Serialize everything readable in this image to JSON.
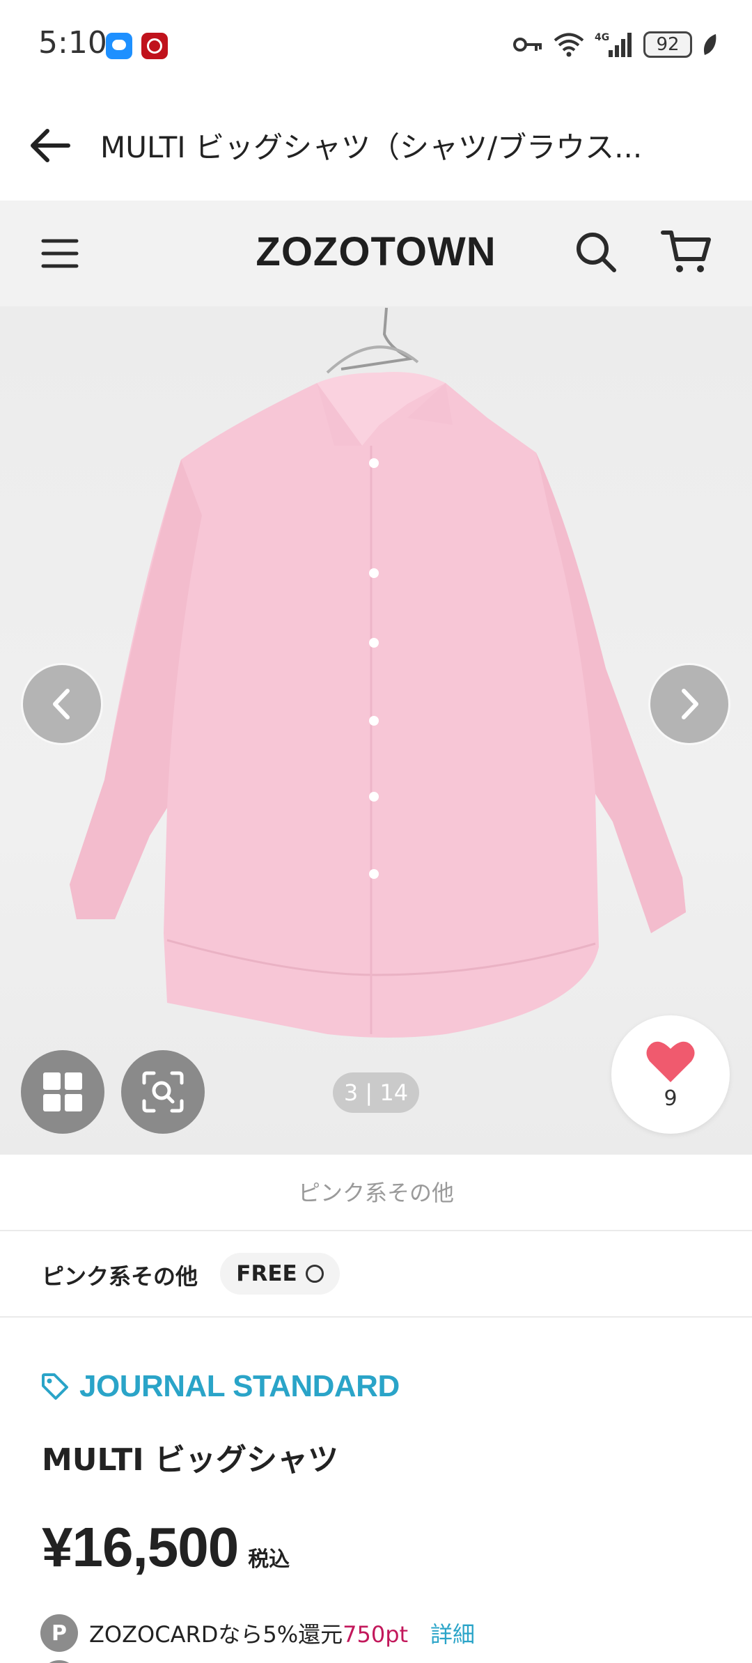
{
  "status_bar": {
    "time": "5:10",
    "battery": "92",
    "icons": [
      "chat-app-icon",
      "bank-app-icon",
      "vpn-key-icon",
      "wifi-icon",
      "signal-4g-icon",
      "battery-icon",
      "leaf-icon"
    ]
  },
  "title_bar": {
    "title": "MULTI ビッグシャツ（シャツ/ブラウス..."
  },
  "site_header": {
    "logo": "ZOZOTOWN"
  },
  "gallery": {
    "pager": "3 | 14",
    "favorite_count": "9",
    "colors": {
      "shirt": "#f7c6d6",
      "heart": "#f05a6e"
    }
  },
  "color_caption": "ピンク系その他",
  "size_row": {
    "color_label": "ピンク系その他",
    "size_label": "FREE"
  },
  "product": {
    "brand": "JOURNAL STANDARD",
    "name": "MULTI ビッグシャツ",
    "price": "¥16,500",
    "tax_label": "税込",
    "points": {
      "badge": "P",
      "text": "ZOZOCARDなら5%還元",
      "value": "750pt",
      "link": "詳細"
    }
  },
  "colors": {
    "brand_accent": "#2aa4c8",
    "points_accent": "#c2185b"
  }
}
